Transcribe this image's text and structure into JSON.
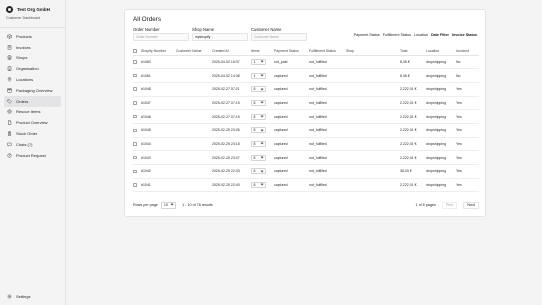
{
  "sidebar": {
    "org_name": "Test Org GmbH",
    "org_subtitle": "Customer Dashboard",
    "items": [
      {
        "label": "Products",
        "icon": "package-icon"
      },
      {
        "label": "Invoices",
        "icon": "receipt-icon"
      },
      {
        "label": "Shops",
        "icon": "store-icon"
      },
      {
        "label": "Organisation",
        "icon": "building-icon"
      },
      {
        "label": "Locations",
        "icon": "map-pin-icon"
      },
      {
        "label": "Packaging Overview",
        "icon": "box-icon"
      },
      {
        "label": "Orders",
        "icon": "tag-icon",
        "active": true
      },
      {
        "label": "Rescue Items",
        "icon": "life-buoy-icon"
      },
      {
        "label": "Product Overview",
        "icon": "file-icon"
      },
      {
        "label": "Stock Order",
        "icon": "clipboard-icon"
      },
      {
        "label": "Chats (7)",
        "icon": "chat-icon"
      },
      {
        "label": "Product Request",
        "icon": "help-circle-icon"
      }
    ],
    "settings_label": "Settings"
  },
  "main": {
    "title": "All Orders",
    "filters": {
      "order_number": {
        "label": "Order Number",
        "placeholder": "Order Number",
        "value": ""
      },
      "shop_name": {
        "label": "Shop Name",
        "placeholder": "Shop Name",
        "value": "myshopify"
      },
      "customer_name": {
        "label": "Customer Name",
        "placeholder": "Customer Name",
        "value": ""
      }
    },
    "column_toggles": [
      {
        "label": "Payment Status",
        "active": false
      },
      {
        "label": "Fulfillment Status",
        "active": false
      },
      {
        "label": "Location",
        "active": false
      },
      {
        "label": "Date Filter",
        "active": true
      },
      {
        "label": "Invoice Status",
        "active": true
      }
    ],
    "table": {
      "headers": {
        "number": "Shopify Number",
        "customer": "Customer Name",
        "created": "Created At",
        "items": "Items",
        "payment": "Payment Status",
        "fulfillment": "Fulfillment Status",
        "shop": "Shop",
        "total": "Total",
        "location": "Location",
        "invoiced": "Invoiced"
      },
      "rows": [
        {
          "number": "#1060",
          "customer": "",
          "created": "2025-04-02 15:07",
          "items": "1",
          "payment": "not_paid",
          "fulfillment": "not_fulfilled",
          "shop": "",
          "total": "8,36 €",
          "location": "dropshipping",
          "invoiced": "No"
        },
        {
          "number": "#1061",
          "customer": "",
          "created": "2025-04-02 14:38",
          "items": "1",
          "payment": "captured",
          "fulfillment": "not_fulfilled",
          "shop": "",
          "total": "8,36 €",
          "location": "dropshipping",
          "invoiced": "No"
        },
        {
          "number": "#1048",
          "customer": "",
          "created": "2025-02-27 07:21",
          "items": "8",
          "payment": "captured",
          "fulfillment": "not_fulfilled",
          "shop": "",
          "total": "2.222,01 €",
          "location": "dropshipping",
          "invoiced": "Yes"
        },
        {
          "number": "#1047",
          "customer": "",
          "created": "2025-02-27 07:15",
          "items": "8",
          "payment": "captured",
          "fulfillment": "not_fulfilled",
          "shop": "",
          "total": "2.222,01 €",
          "location": "dropshipping",
          "invoiced": "Yes"
        },
        {
          "number": "#1046",
          "customer": "",
          "created": "2025-02-27 07:15",
          "items": "8",
          "payment": "captured",
          "fulfillment": "not_fulfilled",
          "shop": "",
          "total": "2.222,01 €",
          "location": "dropshipping",
          "invoiced": "Yes"
        },
        {
          "number": "#1045",
          "customer": "",
          "created": "2025-02-25 23:26",
          "items": "8",
          "payment": "captured",
          "fulfillment": "not_fulfilled",
          "shop": "",
          "total": "2.222,01 €",
          "location": "dropshipping",
          "invoiced": "Yes"
        },
        {
          "number": "#1044",
          "customer": "",
          "created": "2025-02-25 23:18",
          "items": "8",
          "payment": "captured",
          "fulfillment": "not_fulfilled",
          "shop": "",
          "total": "2.222,01 €",
          "location": "dropshipping",
          "invoiced": "Yes"
        },
        {
          "number": "#1043",
          "customer": "",
          "created": "2025-02-25 23:07",
          "items": "8",
          "payment": "captured",
          "fulfillment": "not_fulfilled",
          "shop": "",
          "total": "2.222,01 €",
          "location": "dropshipping",
          "invoiced": "Yes"
        },
        {
          "number": "#1042",
          "customer": "",
          "created": "2025-02-25 22:43",
          "items": "6",
          "payment": "captured",
          "fulfillment": "not_fulfilled",
          "shop": "",
          "total": "36,03 €",
          "location": "dropshipping",
          "invoiced": "Yes"
        },
        {
          "number": "#1041",
          "customer": "",
          "created": "2025-02-25 22:40",
          "items": "8",
          "payment": "captured",
          "fulfillment": "not_fulfilled",
          "shop": "",
          "total": "2.222,01 €",
          "location": "dropshipping",
          "invoiced": "Yes"
        }
      ]
    },
    "pagination": {
      "rows_per_page_label": "Rows per page",
      "rows_per_page_value": "10",
      "range_text": "1 - 10 of 78 results",
      "page_text": "1 of 8 pages",
      "prev_label": "Prev",
      "next_label": "Next"
    }
  }
}
